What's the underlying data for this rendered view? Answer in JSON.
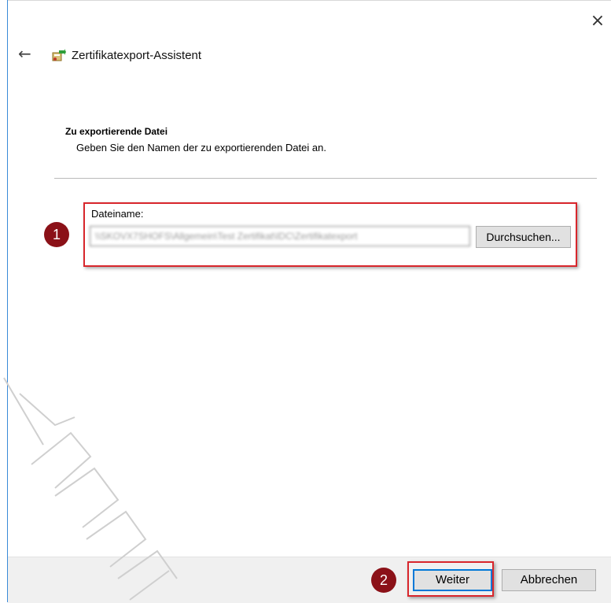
{
  "window": {
    "close_glyph": "×",
    "back_glyph": "←",
    "title": "Zertifikatexport-Assistent"
  },
  "page": {
    "heading": "Zu exportierende Datei",
    "description": "Geben Sie den Namen der zu exportierenden Datei an."
  },
  "file": {
    "label": "Dateiname:",
    "value": "\\\\SKOVX7SHOFS\\Allgemein\\Test Zertifikat\\IDC\\Zertifikatexport",
    "browse_label": "Durchsuchen..."
  },
  "annotations": {
    "badge1": "1",
    "badge2": "2",
    "highlight_color": "#d8262c",
    "badge_color": "#8b1118"
  },
  "footer": {
    "next_label": "Weiter",
    "cancel_label": "Abbrechen"
  },
  "colors": {
    "window_border": "#3a8ad8",
    "footer_bg": "#f0f0f0",
    "default_button_border": "#0078d7"
  }
}
